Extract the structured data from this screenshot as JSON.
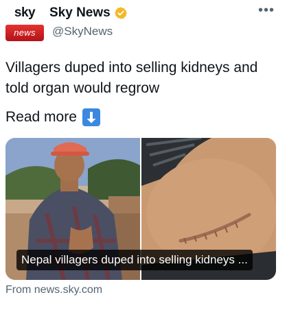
{
  "account": {
    "logo_top": "sky",
    "logo_bottom": "news",
    "display_name": "Sky News",
    "handle": "@SkyNews",
    "verified_icon": "verified-badge-icon",
    "verified_color": "#f2b827"
  },
  "tweet": {
    "text": "Villagers duped into selling kidneys and told organ would regrow",
    "read_more": "Read more",
    "read_more_icon": "down-arrow-emoji-icon",
    "more_icon": "more-options-icon"
  },
  "card": {
    "caption": "Nepal villagers duped into selling kidneys ...",
    "source": "From news.sky.com"
  },
  "colors": {
    "brand_red": "#c8161d",
    "secondary_text": "#536471",
    "emoji_blue": "#3b88e0"
  }
}
